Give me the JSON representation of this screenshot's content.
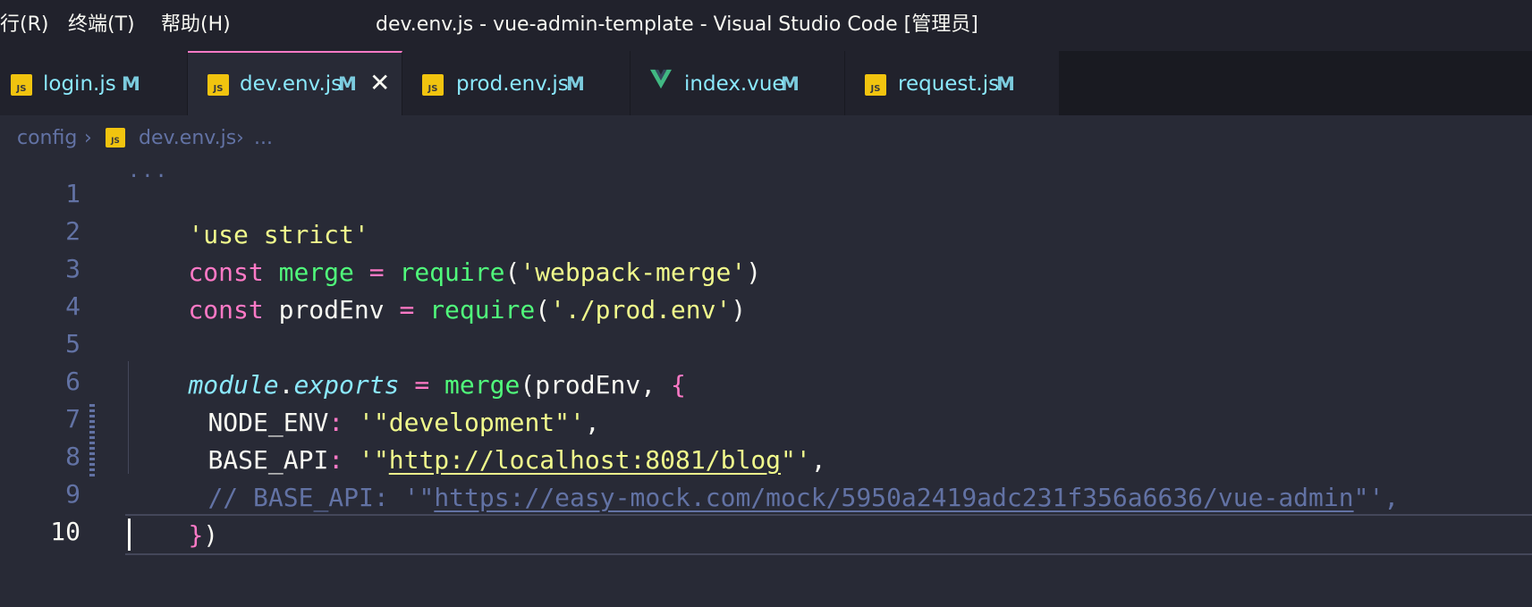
{
  "titlebar": {
    "menu": [
      "行(R)",
      "终端(T)",
      "帮助(H)"
    ],
    "title": "dev.env.js - vue-admin-template - Visual Studio Code [管理员]"
  },
  "tabs": [
    {
      "label": "login.js",
      "modified": "M",
      "icon": "js-file-icon",
      "active": false
    },
    {
      "label": "dev.env.js",
      "modified": "M",
      "icon": "js-file-icon",
      "active": true
    },
    {
      "label": "prod.env.js",
      "modified": "M",
      "icon": "js-file-icon",
      "active": false
    },
    {
      "label": "index.vue",
      "modified": "M",
      "icon": "vue-file-icon",
      "active": false
    },
    {
      "label": "request.js",
      "modified": "M",
      "icon": "js-file-icon",
      "active": false
    }
  ],
  "breadcrumb": {
    "folder": "config",
    "file": "dev.env.js",
    "more": "..."
  },
  "editor": {
    "fold_marker": "...",
    "line_numbers": [
      "1",
      "2",
      "3",
      "4",
      "5",
      "6",
      "7",
      "8",
      "9",
      "10"
    ],
    "code": {
      "l1": "'use strict'",
      "l2_kw": "const",
      "l2_var": "merge",
      "l2_eq": "=",
      "l2_fn": "require",
      "l2_str": "'webpack-merge'",
      "l3_kw": "const",
      "l3_var": "prodEnv",
      "l3_eq": "=",
      "l3_fn": "require",
      "l3_str": "'./prod.env'",
      "l5_mod": "module",
      "l5_exp": "exports",
      "l5_eq": "=",
      "l5_fn": "merge",
      "l5_arg": "prodEnv",
      "l6_key": "NODE_ENV",
      "l6_str": "'\"development\"'",
      "l7_key": "BASE_API",
      "l7_str_open": "'\"",
      "l7_url": "http://localhost:8081/blog",
      "l7_str_close": "\"'",
      "l8_comment": "// BASE_API: '\"",
      "l8_url": "https://easy-mock.com/mock/5950a2419adc231f356a6636/vue-admin",
      "l8_end": "\"',",
      "l9": "})"
    }
  },
  "colors": {
    "background": "#282a36",
    "keyword": "#ff79c6",
    "function": "#50fa7b",
    "string": "#f1fa8c",
    "comment": "#6272a4",
    "tab_text": "#8be9fd"
  }
}
